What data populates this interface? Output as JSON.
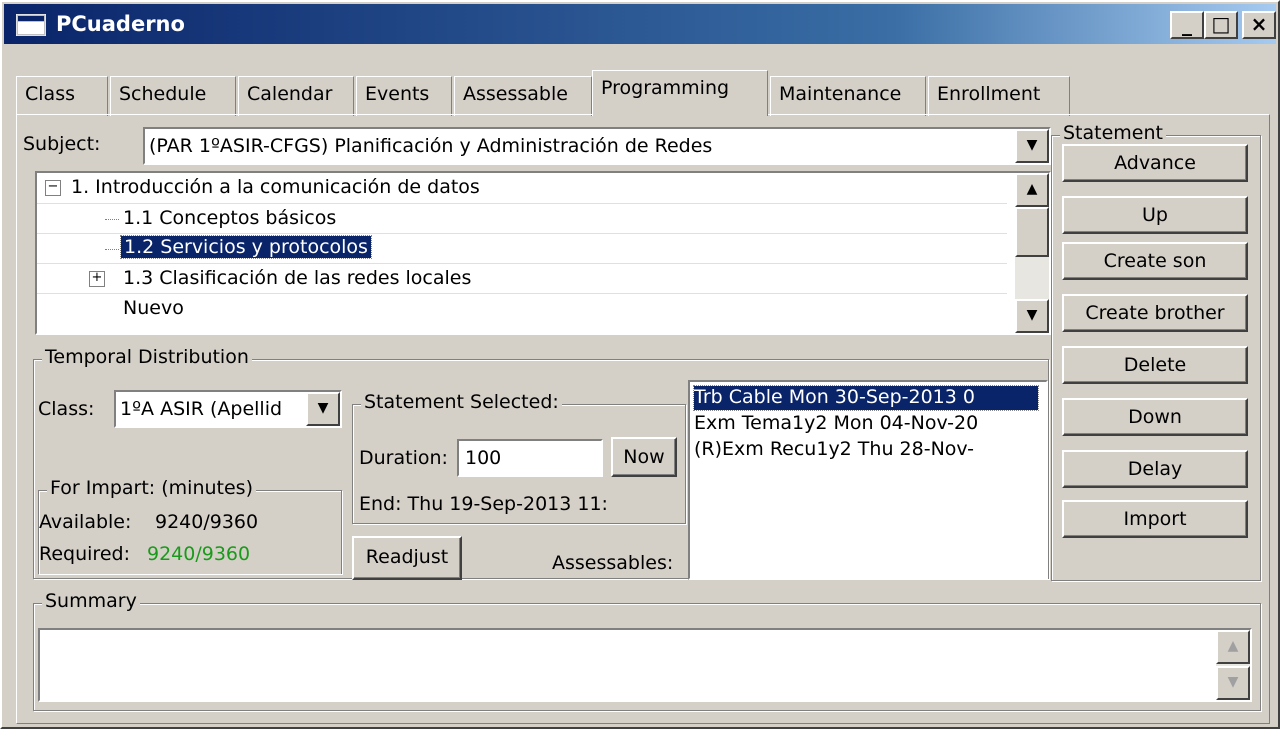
{
  "window": {
    "title": "PCuaderno",
    "minimize": "_",
    "maximize": "□",
    "close": "×"
  },
  "tabs": [
    {
      "label": "Class"
    },
    {
      "label": "Schedule"
    },
    {
      "label": "Calendar"
    },
    {
      "label": "Events"
    },
    {
      "label": "Assessable"
    },
    {
      "label": "Programming",
      "active": true
    },
    {
      "label": "Maintenance"
    },
    {
      "label": "Enrollment"
    }
  ],
  "subject": {
    "label": "Subject:",
    "value": "(PAR 1ºASIR-CFGS) Planificación y Administración de Redes"
  },
  "tree": {
    "items": [
      {
        "label": "1. Introducción a la comunicación de datos",
        "expander": "−"
      },
      {
        "label": "1.1 Conceptos básicos"
      },
      {
        "label": "1.2 Servicios y protocolos",
        "selected": true
      },
      {
        "label": "1.3 Clasificación de las redes locales",
        "expander": "+"
      },
      {
        "label": "Nuevo"
      }
    ]
  },
  "statement": {
    "legend": "Statement",
    "buttons": {
      "advance": "Advance",
      "up": "Up",
      "create_son": "Create son",
      "create_brother": "Create brother",
      "delete": "Delete",
      "down": "Down",
      "delay": "Delay",
      "import": "Import"
    }
  },
  "temporal": {
    "legend": "Temporal Distribution",
    "class_label": "Class:",
    "class_value": "1ºA ASIR (Apellid",
    "impart": {
      "legend": "For Impart: (minutes)",
      "available_label": "Available:",
      "available_value": "9240/9360",
      "required_label": "Required:",
      "required_value": "9240/9360"
    },
    "selected": {
      "legend": "Statement Selected:",
      "duration_label": "Duration:",
      "duration_value": "100",
      "now_label": "Now",
      "end_text": "End: Thu 19-Sep-2013 11:"
    },
    "readjust_label": "Readjust",
    "assessables_label": "Assessables:",
    "assessables": [
      {
        "text": "Trb Cable Mon 30-Sep-2013 0",
        "selected": true
      },
      {
        "text": "Exm Tema1y2 Mon 04-Nov-20"
      },
      {
        "text": "(R)Exm Recu1y2 Thu 28-Nov-"
      }
    ]
  },
  "summary": {
    "legend": "Summary",
    "value": ""
  }
}
